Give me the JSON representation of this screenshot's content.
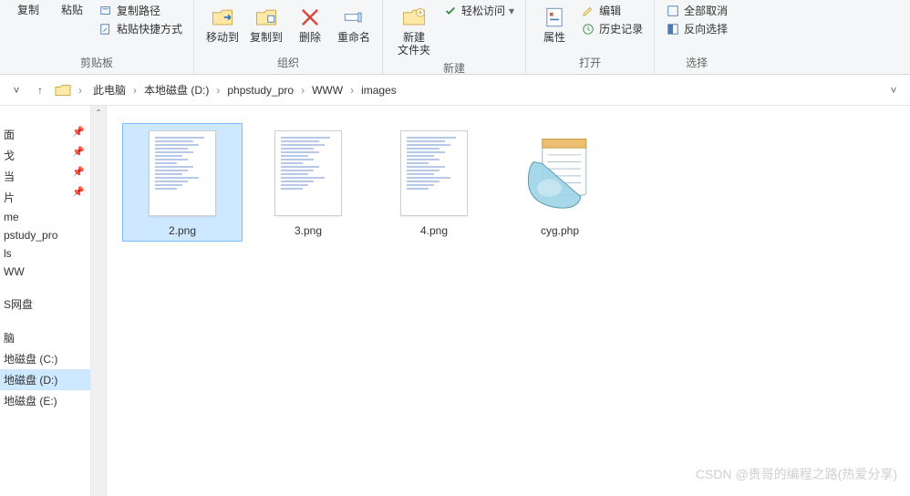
{
  "ribbon": {
    "clipboard": {
      "label": "剪贴板",
      "copy": "复制",
      "paste": "粘贴",
      "copy_path": "复制路径",
      "paste_shortcut": "粘贴快捷方式"
    },
    "organize": {
      "label": "组织",
      "move_to": "移动到",
      "copy_to": "复制到",
      "delete": "删除",
      "rename": "重命名"
    },
    "new": {
      "label": "新建",
      "new_folder_l1": "新建",
      "new_folder_l2": "文件夹",
      "easy_access": "轻松访问"
    },
    "open": {
      "label": "打开",
      "properties": "属性",
      "edit": "编辑",
      "history": "历史记录"
    },
    "select": {
      "label": "选择",
      "select_all": "全部取消",
      "invert": "反向选择"
    }
  },
  "breadcrumbs": [
    "此电脑",
    "本地磁盘 (D:)",
    "phpstudy_pro",
    "WWW",
    "images"
  ],
  "navpane": {
    "pinned": [
      "面",
      "戈",
      "当",
      "片"
    ],
    "items": [
      "me",
      "pstudy_pro",
      "ls",
      "WW"
    ],
    "items2": [
      "S网盘"
    ],
    "items3": [
      "脑",
      "地磁盘 (C:)",
      "地磁盘 (D:)",
      "地磁盘 (E:)"
    ],
    "selected": "地磁盘 (D:)"
  },
  "files": [
    {
      "name": "2.png",
      "type": "image",
      "selected": true
    },
    {
      "name": "3.png",
      "type": "image",
      "selected": false
    },
    {
      "name": "4.png",
      "type": "image",
      "selected": false
    },
    {
      "name": "cyg.php",
      "type": "php",
      "selected": false
    }
  ],
  "watermark": "CSDN @贵哥的编程之路(热爱分享)"
}
